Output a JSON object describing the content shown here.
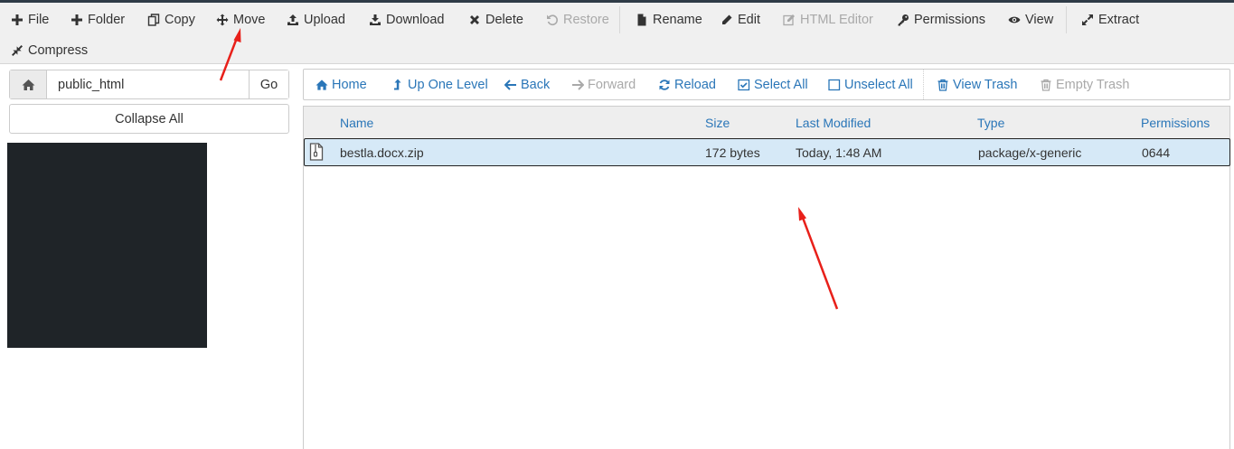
{
  "toolbar": {
    "file": "File",
    "folder": "Folder",
    "copy": "Copy",
    "move": "Move",
    "upload": "Upload",
    "download": "Download",
    "delete": "Delete",
    "restore": "Restore",
    "rename": "Rename",
    "edit": "Edit",
    "html_editor": "HTML Editor",
    "permissions": "Permissions",
    "view": "View",
    "extract": "Extract",
    "compress": "Compress"
  },
  "sidebar": {
    "path_value": "public_html",
    "go_label": "Go",
    "collapse_label": "Collapse All"
  },
  "nav": {
    "home": "Home",
    "up_one_level": "Up One Level",
    "back": "Back",
    "forward": "Forward",
    "reload": "Reload",
    "select_all": "Select All",
    "unselect_all": "Unselect All",
    "view_trash": "View Trash",
    "empty_trash": "Empty Trash"
  },
  "table": {
    "columns": [
      "Name",
      "Size",
      "Last Modified",
      "Type",
      "Permissions"
    ],
    "rows": [
      {
        "name": "bestla.docx.zip",
        "size": "172 bytes",
        "modified": "Today, 1:48 AM",
        "type": "package/x-generic",
        "permissions": "0644"
      }
    ]
  },
  "colors": {
    "accent": "#2a76b8",
    "selected_row": "#d6e9f7",
    "annotation": "#e8201a"
  }
}
